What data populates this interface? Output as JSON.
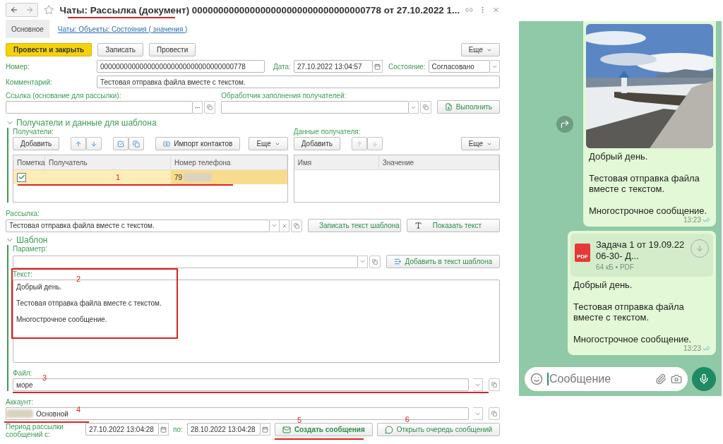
{
  "window": {
    "title": "Чаты: Рассылка (документ) 000000000000000000000000000000000778 от 27.10.2022 1..."
  },
  "tabs": [
    {
      "label": "Основное",
      "selected": true
    },
    {
      "label": "Чаты: Объекты: Состояния ( значения )",
      "selected": false
    }
  ],
  "command_bar": {
    "buttons": [
      {
        "label": "Провести и закрыть",
        "kind": "primary"
      },
      {
        "label": "Записать",
        "kind": "plain"
      },
      {
        "label": "Провести",
        "kind": "plain"
      }
    ],
    "more": "Еще"
  },
  "header": {
    "number_label": "Номер:",
    "number": "0000000000000000000000000000000000778",
    "date_label": "Дата:",
    "date": "27.10.2022 13:04:57",
    "state_label": "Состояние:",
    "state": "Согласовано",
    "comment_label": "Комментарий:",
    "comment": "Тестовая отправка файла вместе с текстом."
  },
  "basis": {
    "link_label": "Ссылка (основание для рассылки):",
    "handler_label": "Обработчик заполнения получателей:",
    "run_button": "Выполнить"
  },
  "recipients_section": {
    "title": "Получатели и данные для шаблона",
    "expanded": true,
    "recipients": {
      "label": "Получатели:",
      "add": "Добавить",
      "icon_buttons": [
        {
          "kind": "up",
          "disabled": false
        },
        {
          "kind": "down",
          "disabled": false
        },
        {
          "kind": "check",
          "disabled": false
        },
        {
          "kind": "copy",
          "disabled": false
        }
      ],
      "import": "Импорт контактов",
      "more": "Еще",
      "columns": [
        "Пометка",
        "Получатель",
        "Номер телефона"
      ],
      "rows": [
        {
          "checked": true,
          "phone": "79",
          "selected": true
        }
      ],
      "annotation": "1"
    },
    "recipient_data": {
      "label": "Данные получателя:",
      "add": "Добавить",
      "icon_buttons": [
        {
          "kind": "up",
          "disabled": true
        },
        {
          "kind": "down",
          "disabled": true
        }
      ],
      "more": "Еще",
      "columns": [
        "Имя",
        "Значение"
      ]
    }
  },
  "mailing": {
    "label": "Рассылка:",
    "value": "Тестовая отправка файла вместе с текстом.",
    "save_button": "Записать текст шаблона",
    "show_button": "Показать текст"
  },
  "template_section": {
    "title": "Шаблон",
    "expanded": true,
    "parameter_label": "Параметр:",
    "add_button": "Добавить в текст шаблона",
    "text_label": "Текст:",
    "text": "Добрый день.\n\nТестовая отправка файла вместе с текстом.\n\nМногострочное сообщение.",
    "text_annotation": "2",
    "file_label": "Файл:",
    "file": "море",
    "file_annotation": "3"
  },
  "account": {
    "label": "Аккаунт:",
    "value": "Основной",
    "annotation": "4"
  },
  "period": {
    "label": "Период рассылки сообщений с:",
    "from": "27.10.2022 13:04:28",
    "to_label": "по:",
    "to": "28.10.2022 13:04:28",
    "create_button": "Создать сообщения",
    "create_annotation": "5",
    "queue_button": "Открыть очередь сообщений",
    "queue_annotation": "6"
  },
  "chat": {
    "messages": [
      {
        "lines": [
          "Добрый день.",
          "Тестовая отправка файла вместе с текстом.",
          "Многострочное сообщение."
        ],
        "time": "13:23"
      },
      {
        "kind": "file",
        "file_type": "PDF",
        "file_name": "Задача  1 от 19.09.22 06-30- Д...",
        "file_meta": "64 кБ • PDF",
        "lines": [
          "Добрый день.",
          "Тестовая отправка файла вместе с текстом.",
          "Многострочное сообщение."
        ],
        "time": "13:23"
      }
    ],
    "compose_placeholder": "Сообщение"
  }
}
